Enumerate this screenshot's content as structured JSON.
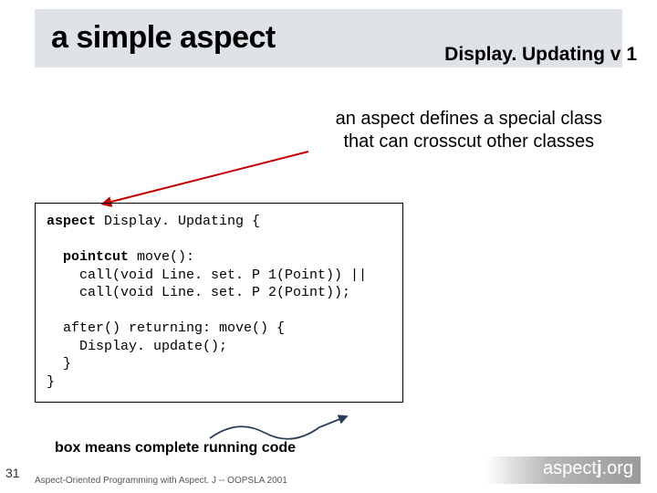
{
  "title": "a simple aspect",
  "version": "Display. Updating v 1",
  "note1_line1": "an aspect defines a special class",
  "note1_line2": "that can crosscut other classes",
  "code": {
    "l1a": "aspect",
    "l1b": " Display. Updating {",
    "l2a": "  pointcut",
    "l2b": " move():",
    "l3": "    call(void Line. set. P 1(Point)) ||",
    "l4": "    call(void Line. set. P 2(Point));",
    "l5": "  after() returning: move() {",
    "l6": "    Display. update();",
    "l7": "  }",
    "l8": "}"
  },
  "note2": "box means complete running code",
  "footer": "Aspect-Oriented Programming with Aspect. J -- OOPSLA 2001",
  "pagenum": "31",
  "logo_text_plain": "aspect",
  "logo_text_bold": "j",
  "logo_text_suffix": ".org"
}
